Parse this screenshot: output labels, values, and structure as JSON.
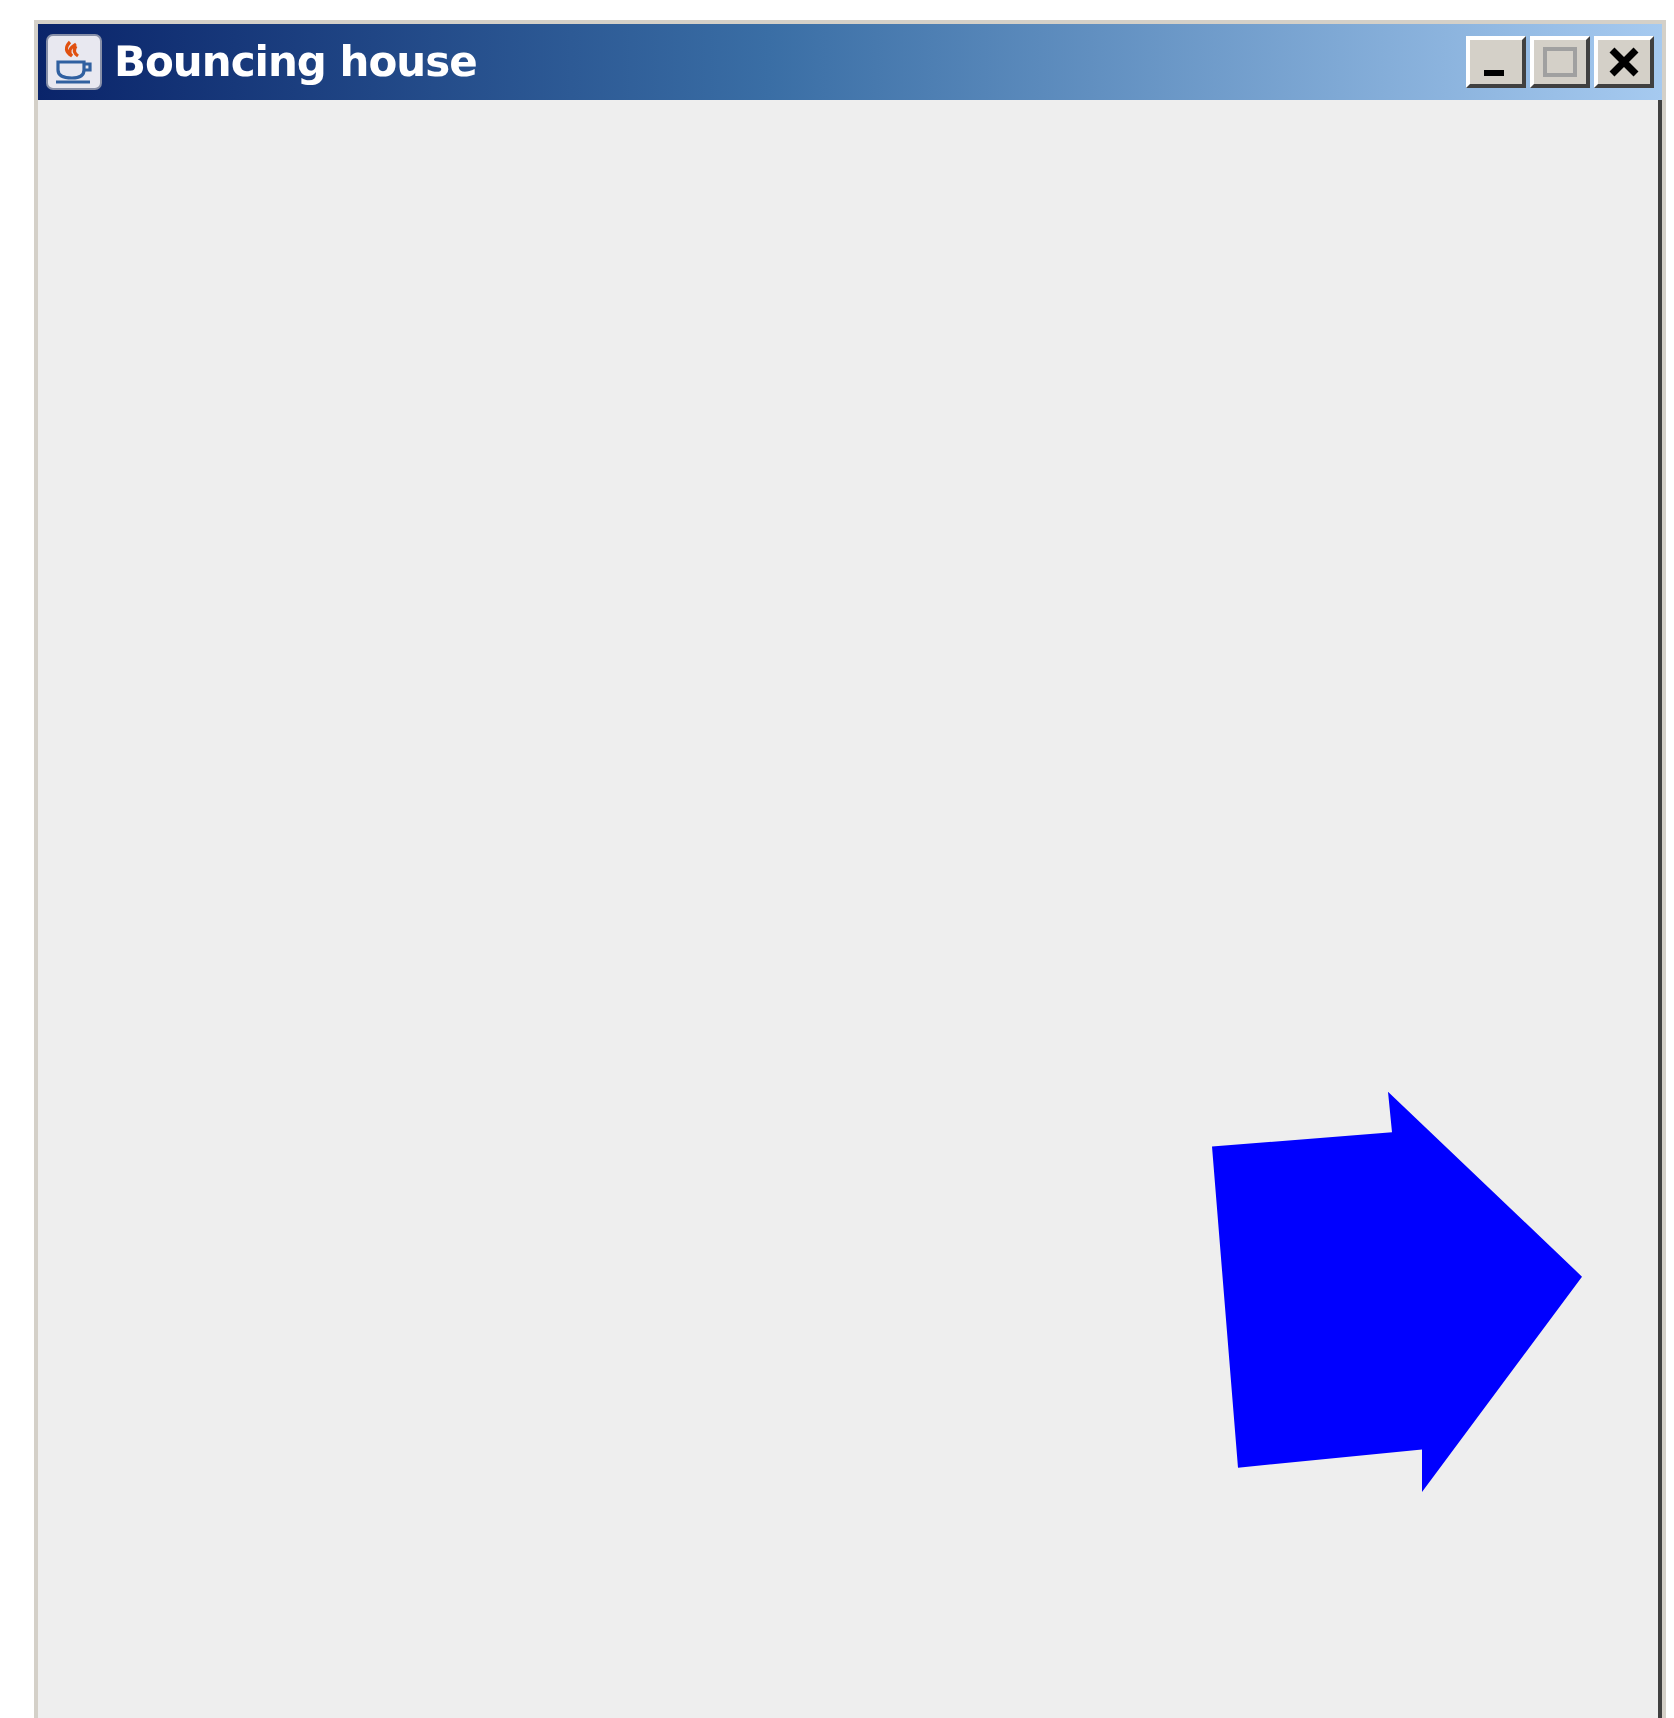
{
  "window": {
    "title": "Bouncing house"
  }
}
